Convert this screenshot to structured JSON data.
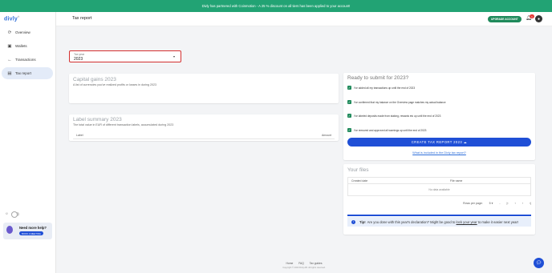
{
  "banner": {
    "text": "Divly has partnered with Coinmotion - A 25 % discount on all tiers has been applied to your account!"
  },
  "app": {
    "logo": "divly",
    "logo_mark": "®"
  },
  "sidebar": {
    "items": [
      {
        "label": "Overview",
        "icon": "refresh-icon"
      },
      {
        "label": "Wallets",
        "icon": "wallet-icon"
      },
      {
        "label": "Transactions",
        "icon": "arrow-left-icon"
      },
      {
        "label": "Tax report",
        "icon": "document-icon",
        "active": true
      }
    ],
    "theme_toggle_icon": "sun-icon",
    "help": {
      "title": "Need more help?",
      "button": "BOOK A MEETING"
    }
  },
  "header": {
    "title": "Tax report",
    "upgrade_label": "UPGRADE ACCOUNT",
    "notifications_count": "1"
  },
  "tax_year": {
    "label": "Tax year",
    "value": "2023"
  },
  "capital_gains": {
    "title": "Capital gains 2023",
    "subtitle": "A list of currencies you've realized profits or losses in during 2023"
  },
  "label_summary": {
    "title": "Label summary 2023",
    "subtitle": "The total value in EUR of different transaction labels, accumulated during 2023",
    "columns": [
      "Label",
      "Amount"
    ]
  },
  "ready": {
    "title": "Ready to submit for 2023?",
    "checks": [
      "I've added all my transactions up until the end of 2023",
      "I've confirmed that my balance on the Overview page matches my actual balance",
      "I've labeled deposits made from staking, rewards etc up until the end of 2023",
      "I've removed and approved all warnings up until the end of 2023"
    ],
    "create_button": "CREATE TAX REPORT 2023",
    "link": "What is included in the Divly tax report?"
  },
  "files": {
    "title": "Your files",
    "columns": [
      "Created date",
      "File name"
    ],
    "empty": "No data available",
    "rows_per_page_label": "Rows per page:",
    "rows_per_page_value": "5",
    "range": "-",
    "progress": 1.0
  },
  "tip": {
    "label": "Tip!",
    "text_before": "Are you done with this year's declaration? Might be good to",
    "link": "lock your year",
    "text_after": "to make it easier next year!"
  },
  "footer": {
    "links": [
      "Home",
      "FAQ",
      "Tax guides"
    ],
    "copyright": "Copyright © 2023 Divly AB. All rights reserved."
  }
}
